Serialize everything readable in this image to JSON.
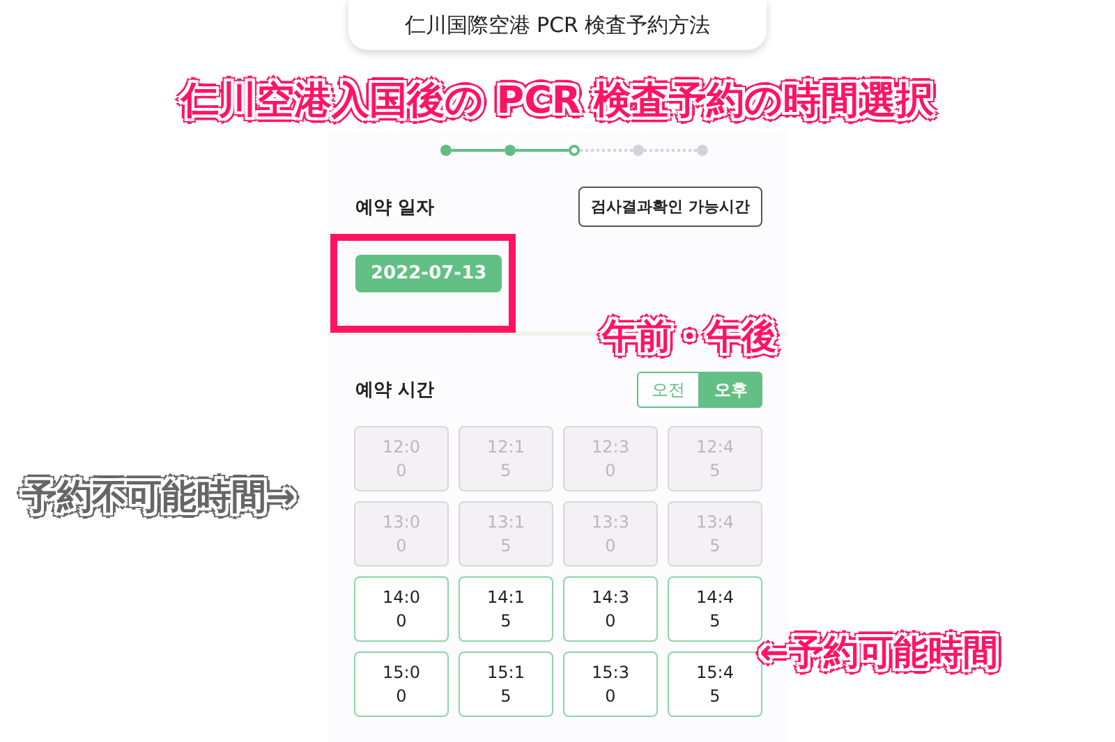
{
  "header": {
    "title": "仁川国際空港 PCR 検査予約方法"
  },
  "headline": "仁川空港入国後の PCR 検査予約の時間選択",
  "steps": [
    {
      "kind": "done"
    },
    {
      "kind": "done"
    },
    {
      "kind": "current"
    },
    {
      "kind": "todo"
    },
    {
      "kind": "todo"
    }
  ],
  "date_section": {
    "label": "예약 일자",
    "button": "검사결과확인 가능시간",
    "date": "2022-07-13"
  },
  "time_section": {
    "label": "예약 시간",
    "toggle": [
      {
        "label": "오전",
        "selected": false
      },
      {
        "label": "오후",
        "selected": true
      }
    ]
  },
  "slots": [
    {
      "lines": [
        "12:0",
        "0"
      ],
      "available": false
    },
    {
      "lines": [
        "12:1",
        "5"
      ],
      "available": false
    },
    {
      "lines": [
        "12:3",
        "0"
      ],
      "available": false
    },
    {
      "lines": [
        "12:4",
        "5"
      ],
      "available": false
    },
    {
      "lines": [
        "13:0",
        "0"
      ],
      "available": false
    },
    {
      "lines": [
        "13:1",
        "5"
      ],
      "available": false
    },
    {
      "lines": [
        "13:3",
        "0"
      ],
      "available": false
    },
    {
      "lines": [
        "13:4",
        "5"
      ],
      "available": false
    },
    {
      "lines": [
        "14:0",
        "0"
      ],
      "available": true
    },
    {
      "lines": [
        "14:1",
        "5"
      ],
      "available": true
    },
    {
      "lines": [
        "14:3",
        "0"
      ],
      "available": true
    },
    {
      "lines": [
        "14:4",
        "5"
      ],
      "available": true
    },
    {
      "lines": [
        "15:0",
        "0"
      ],
      "available": true
    },
    {
      "lines": [
        "15:1",
        "5"
      ],
      "available": true
    },
    {
      "lines": [
        "15:3",
        "0"
      ],
      "available": true
    },
    {
      "lines": [
        "15:4",
        "5"
      ],
      "available": true
    }
  ],
  "annotations": {
    "am_pm": "午前・午後",
    "unavailable": "予約不可能時間→",
    "available": "←予約可能時間"
  }
}
